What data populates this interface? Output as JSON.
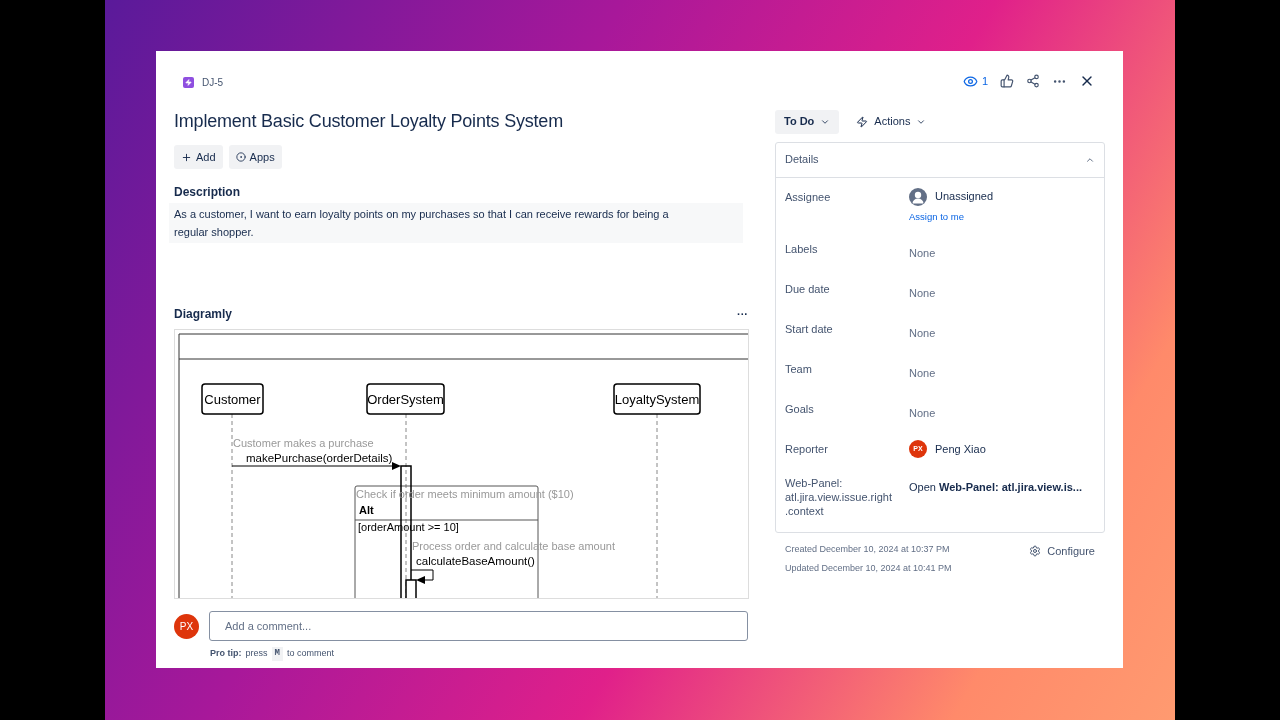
{
  "issue": {
    "key": "DJ-5",
    "title": "Implement Basic Customer Loyalty Points System",
    "buttons": [
      "Add",
      "Apps"
    ]
  },
  "header_actions": {
    "watchers": "1"
  },
  "description": {
    "heading": "Description",
    "text": "As a customer, I want to earn loyalty points on my purchases so that I can receive rewards for being a regular shopper."
  },
  "diagramly": {
    "heading": "Diagramly",
    "more": "···",
    "participants": [
      "Customer",
      "OrderSystem",
      "LoyaltySystem"
    ],
    "note_1": "Customer makes a purchase",
    "message_1": "makePurchase(orderDetails)",
    "alt_note": "Check if order meets minimum amount ($10)",
    "alt_label": "Alt",
    "alt_condition": "[orderAmount >= 10]",
    "note_2": "Process order and calculate base amount",
    "message_2": "calculateBaseAmount()"
  },
  "comment": {
    "avatar": "PX",
    "placeholder": "Add a comment...",
    "tip_label": "Pro tip:",
    "tip_before": "press",
    "tip_key": "M",
    "tip_after": "to comment"
  },
  "status": {
    "label": "To Do",
    "actions": "Actions"
  },
  "details": {
    "heading": "Details",
    "expanded": true,
    "rows": [
      {
        "label": "Assignee",
        "kind": "user",
        "value": "Unassigned",
        "link": "Assign to me"
      },
      {
        "label": "Labels",
        "kind": "text",
        "value": "None"
      },
      {
        "label": "Due date",
        "kind": "text",
        "value": "None"
      },
      {
        "label": "Start date",
        "kind": "text",
        "value": "None"
      },
      {
        "label": "Team",
        "kind": "text",
        "value": "None"
      },
      {
        "label": "Goals",
        "kind": "text",
        "value": "None"
      },
      {
        "label": "Reporter",
        "kind": "person",
        "value": "Peng Xiao",
        "initials": "PX"
      },
      {
        "label": "Web-Panel: atl.jira.view.issue.right.context",
        "kind": "rich",
        "value": "Open **Web-Panel: atl.jira.view.is...**"
      }
    ]
  },
  "footer": {
    "created": "Created December 10, 2024 at 10:37 PM",
    "updated": "Updated December 10, 2024 at 10:41 PM",
    "configure": "Configure"
  }
}
